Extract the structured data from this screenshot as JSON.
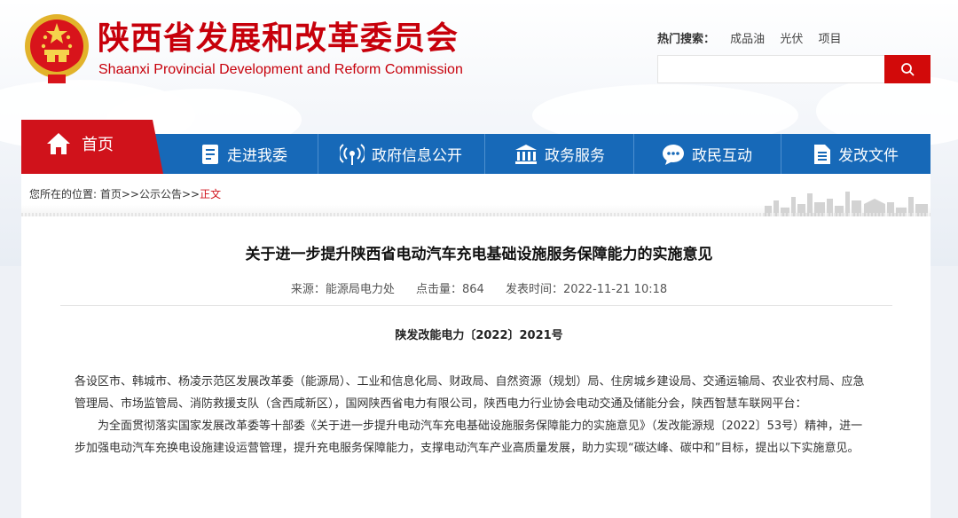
{
  "header": {
    "title_cn": "陕西省发展和改革委员会",
    "title_en": "Shaanxi Provincial Development and Reform Commission"
  },
  "search": {
    "hot_label": "热门搜索：",
    "hot_keywords": [
      "成品油",
      "光伏",
      "项目"
    ],
    "placeholder": ""
  },
  "nav": {
    "home": "首页",
    "items": [
      "走进我委",
      "政府信息公开",
      "政务服务",
      "政民互动",
      "发改文件"
    ]
  },
  "breadcrumb": {
    "prefix": "您所在的位置:",
    "items": [
      "首页>>",
      "公示公告>>"
    ],
    "current": "正文"
  },
  "article": {
    "title": "关于进一步提升陕西省电动汽车充电基础设施服务保障能力的实施意见",
    "source": "来源：能源局电力处",
    "clicks": "点击量：864",
    "published": "发表时间：2022-11-21 10:18",
    "doc_number": "陕发改能电力〔2022〕2021号",
    "paragraphs": [
      "各设区市、韩城市、杨凌示范区发展改革委（能源局）、工业和信息化局、财政局、自然资源（规划）局、住房城乡建设局、交通运输局、农业农村局、应急管理局、市场监管局、消防救援支队（含西咸新区），国网陕西省电力有限公司，陕西电力行业协会电动交通及储能分会，陕西智慧车联网平台：",
      "为全面贯彻落实国家发展改革委等十部委《关于进一步提升电动汽车充电基础设施服务保障能力的实施意见》（发改能源规〔2022〕53号）精神，进一步加强电动汽车充换电设施建设运营管理，提升充电服务保障能力，支撑电动汽车产业高质量发展，助力实现“碳达峰、碳中和”目标，提出以下实施意见。"
    ]
  },
  "colors": {
    "brand_red": "#c7000b",
    "nav_blue": "#1769b8",
    "home_red": "#d0121b"
  }
}
